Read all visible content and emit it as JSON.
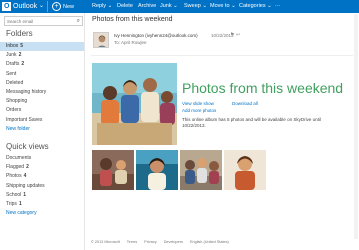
{
  "topbar": {
    "brand": "Outlook",
    "new": "New",
    "reply": "Reply",
    "delete": "Delete",
    "archive": "Archive",
    "junk": "Junk",
    "sweep": "Sweep",
    "move_to": "Move to",
    "categories": "Categories",
    "more": "···"
  },
  "sidebar": {
    "search_placeholder": "Search email",
    "folders_title": "Folders",
    "folders": [
      {
        "label": "Inbox",
        "count": "5"
      },
      {
        "label": "Junk",
        "count": "2"
      },
      {
        "label": "Drafts",
        "count": "2"
      },
      {
        "label": "Sent",
        "count": ""
      },
      {
        "label": "Deleted",
        "count": ""
      },
      {
        "label": "Messaging history",
        "count": ""
      },
      {
        "label": "Shopping",
        "count": ""
      },
      {
        "label": "Orders",
        "count": ""
      },
      {
        "label": "Important Saves",
        "count": ""
      },
      {
        "label": "New folder",
        "count": ""
      }
    ],
    "quick_views_title": "Quick views",
    "quick_views": [
      {
        "label": "Documents",
        "count": ""
      },
      {
        "label": "Flagged",
        "count": "2"
      },
      {
        "label": "Photos",
        "count": "4"
      },
      {
        "label": "Shipping updates",
        "count": ""
      },
      {
        "label": "School",
        "count": "1"
      },
      {
        "label": "Trips",
        "count": "1"
      },
      {
        "label": "New category",
        "count": ""
      }
    ]
  },
  "message": {
    "subject": "Photos from this weekend",
    "from": "Ivy Hennington (ivyhenn24@outlook.com)",
    "to": "To: Aprit Rowjee",
    "date": "10/22/2013",
    "hero_title": "Photos from this weekend",
    "view_slideshow": "View slide show",
    "download_all": "Download all",
    "add_more": "Add more photos",
    "body": "This online album has 5 photos and will be available on SkyDrive until 10/22/2013."
  },
  "footer": {
    "copyright": "© 2013 Microsoft",
    "terms": "Terms",
    "privacy": "Privacy",
    "developers": "Developers",
    "language": "English (United States)"
  },
  "colors": {
    "accent": "#0072c6",
    "selected": "#c7e0f4",
    "hero_title": "#40a060"
  }
}
